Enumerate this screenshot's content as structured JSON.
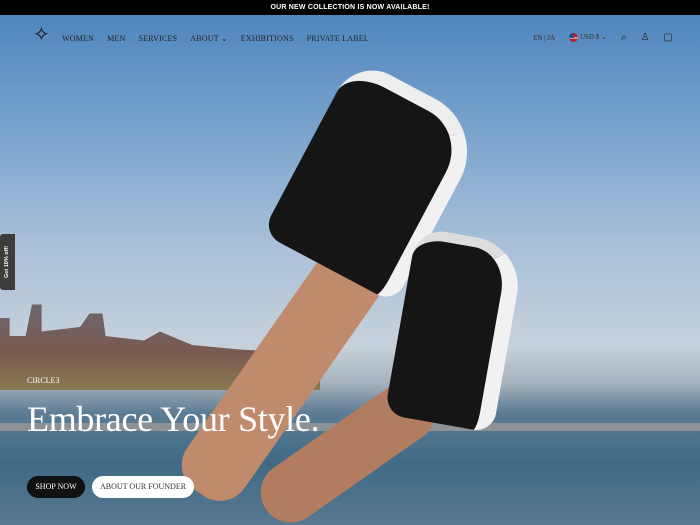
{
  "announcement": "OUR NEW COLLECTION IS NOW AVAILABLE!",
  "nav": {
    "logo": "✧",
    "items": [
      "WOMEN",
      "MEN",
      "SERVICES",
      "ABOUT",
      "EXHIBITIONS",
      "PRIVATE LABEL"
    ],
    "languages": "EN | JA",
    "currency": "USD $"
  },
  "side_tab": "Get 10% off!",
  "hero": {
    "brand": "CIRCLE3",
    "headline": "Embrace Your Style.",
    "shop_button": "SHOP NOW",
    "founder_button": "ABOUT OUR FOUNDER"
  }
}
